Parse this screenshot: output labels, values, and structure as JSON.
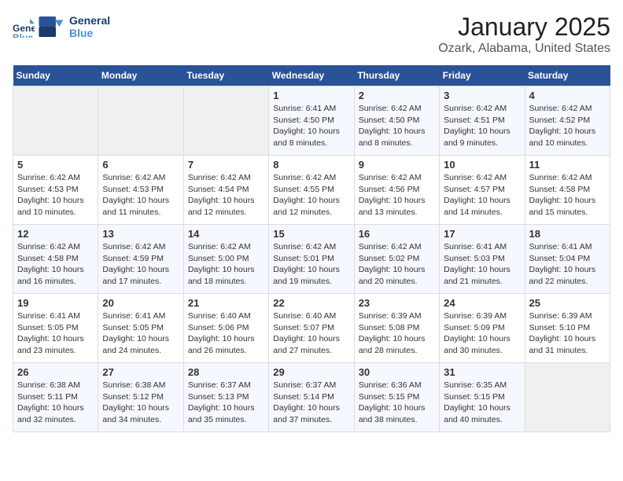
{
  "header": {
    "logo_line1": "General",
    "logo_line2": "Blue",
    "main_title": "January 2025",
    "subtitle": "Ozark, Alabama, United States"
  },
  "weekdays": [
    "Sunday",
    "Monday",
    "Tuesday",
    "Wednesday",
    "Thursday",
    "Friday",
    "Saturday"
  ],
  "weeks": [
    [
      {
        "day": "",
        "empty": true
      },
      {
        "day": "",
        "empty": true
      },
      {
        "day": "",
        "empty": true
      },
      {
        "day": "1",
        "sunrise": "6:41 AM",
        "sunset": "4:50 PM",
        "daylight": "10 hours and 8 minutes."
      },
      {
        "day": "2",
        "sunrise": "6:42 AM",
        "sunset": "4:50 PM",
        "daylight": "10 hours and 8 minutes."
      },
      {
        "day": "3",
        "sunrise": "6:42 AM",
        "sunset": "4:51 PM",
        "daylight": "10 hours and 9 minutes."
      },
      {
        "day": "4",
        "sunrise": "6:42 AM",
        "sunset": "4:52 PM",
        "daylight": "10 hours and 10 minutes."
      }
    ],
    [
      {
        "day": "5",
        "sunrise": "6:42 AM",
        "sunset": "4:53 PM",
        "daylight": "10 hours and 10 minutes."
      },
      {
        "day": "6",
        "sunrise": "6:42 AM",
        "sunset": "4:53 PM",
        "daylight": "10 hours and 11 minutes."
      },
      {
        "day": "7",
        "sunrise": "6:42 AM",
        "sunset": "4:54 PM",
        "daylight": "10 hours and 12 minutes."
      },
      {
        "day": "8",
        "sunrise": "6:42 AM",
        "sunset": "4:55 PM",
        "daylight": "10 hours and 12 minutes."
      },
      {
        "day": "9",
        "sunrise": "6:42 AM",
        "sunset": "4:56 PM",
        "daylight": "10 hours and 13 minutes."
      },
      {
        "day": "10",
        "sunrise": "6:42 AM",
        "sunset": "4:57 PM",
        "daylight": "10 hours and 14 minutes."
      },
      {
        "day": "11",
        "sunrise": "6:42 AM",
        "sunset": "4:58 PM",
        "daylight": "10 hours and 15 minutes."
      }
    ],
    [
      {
        "day": "12",
        "sunrise": "6:42 AM",
        "sunset": "4:58 PM",
        "daylight": "10 hours and 16 minutes."
      },
      {
        "day": "13",
        "sunrise": "6:42 AM",
        "sunset": "4:59 PM",
        "daylight": "10 hours and 17 minutes."
      },
      {
        "day": "14",
        "sunrise": "6:42 AM",
        "sunset": "5:00 PM",
        "daylight": "10 hours and 18 minutes."
      },
      {
        "day": "15",
        "sunrise": "6:42 AM",
        "sunset": "5:01 PM",
        "daylight": "10 hours and 19 minutes."
      },
      {
        "day": "16",
        "sunrise": "6:42 AM",
        "sunset": "5:02 PM",
        "daylight": "10 hours and 20 minutes."
      },
      {
        "day": "17",
        "sunrise": "6:41 AM",
        "sunset": "5:03 PM",
        "daylight": "10 hours and 21 minutes."
      },
      {
        "day": "18",
        "sunrise": "6:41 AM",
        "sunset": "5:04 PM",
        "daylight": "10 hours and 22 minutes."
      }
    ],
    [
      {
        "day": "19",
        "sunrise": "6:41 AM",
        "sunset": "5:05 PM",
        "daylight": "10 hours and 23 minutes."
      },
      {
        "day": "20",
        "sunrise": "6:41 AM",
        "sunset": "5:05 PM",
        "daylight": "10 hours and 24 minutes."
      },
      {
        "day": "21",
        "sunrise": "6:40 AM",
        "sunset": "5:06 PM",
        "daylight": "10 hours and 26 minutes."
      },
      {
        "day": "22",
        "sunrise": "6:40 AM",
        "sunset": "5:07 PM",
        "daylight": "10 hours and 27 minutes."
      },
      {
        "day": "23",
        "sunrise": "6:39 AM",
        "sunset": "5:08 PM",
        "daylight": "10 hours and 28 minutes."
      },
      {
        "day": "24",
        "sunrise": "6:39 AM",
        "sunset": "5:09 PM",
        "daylight": "10 hours and 30 minutes."
      },
      {
        "day": "25",
        "sunrise": "6:39 AM",
        "sunset": "5:10 PM",
        "daylight": "10 hours and 31 minutes."
      }
    ],
    [
      {
        "day": "26",
        "sunrise": "6:38 AM",
        "sunset": "5:11 PM",
        "daylight": "10 hours and 32 minutes."
      },
      {
        "day": "27",
        "sunrise": "6:38 AM",
        "sunset": "5:12 PM",
        "daylight": "10 hours and 34 minutes."
      },
      {
        "day": "28",
        "sunrise": "6:37 AM",
        "sunset": "5:13 PM",
        "daylight": "10 hours and 35 minutes."
      },
      {
        "day": "29",
        "sunrise": "6:37 AM",
        "sunset": "5:14 PM",
        "daylight": "10 hours and 37 minutes."
      },
      {
        "day": "30",
        "sunrise": "6:36 AM",
        "sunset": "5:15 PM",
        "daylight": "10 hours and 38 minutes."
      },
      {
        "day": "31",
        "sunrise": "6:35 AM",
        "sunset": "5:15 PM",
        "daylight": "10 hours and 40 minutes."
      },
      {
        "day": "",
        "empty": true
      }
    ]
  ]
}
